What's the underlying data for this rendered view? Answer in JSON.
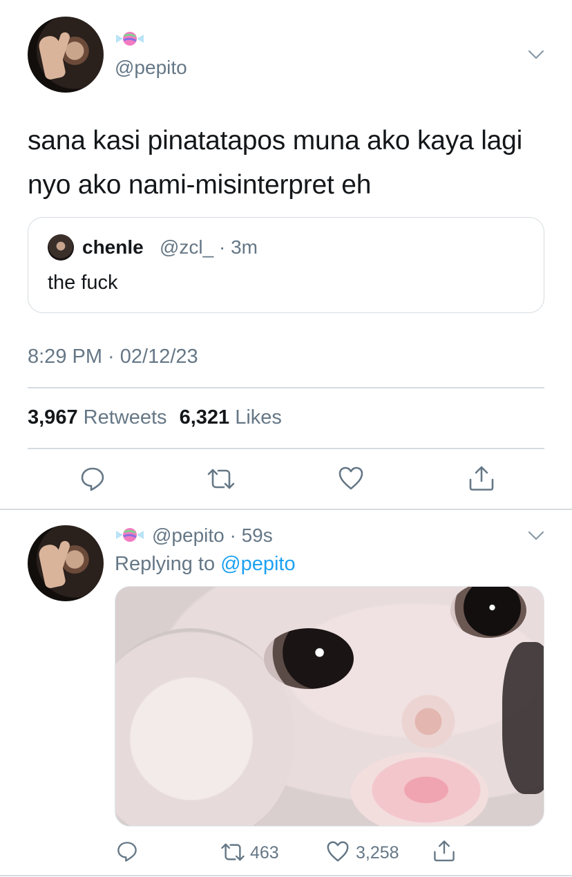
{
  "main_tweet": {
    "handle": "@pepito",
    "text": "sana kasi pinatatapos muna ako kaya lagi nyo ako nami-misinterpret eh",
    "quoted": {
      "name": "chenle",
      "handle_time": "@zcl_ · 3m",
      "text": "the fuck"
    },
    "timestamp": "8:29 PM · 02/12/23",
    "retweets_count": "3,967",
    "retweets_label": "Retweets",
    "likes_count": "6,321",
    "likes_label": "Likes"
  },
  "reply_tweet": {
    "handle_time": "@pepito · 59s",
    "replying_prefix": "Replying to",
    "replying_target": "@pepito",
    "retweet_count": "463",
    "like_count": "3,258"
  },
  "icons": {
    "candy": "candy-icon",
    "menu": "chevron-down-icon",
    "reply": "comment-icon",
    "retweet": "retweet-icon",
    "like": "heart-icon",
    "share": "share-icon"
  },
  "colors": {
    "text": "#14171a",
    "secondary": "#657786",
    "link": "#1da1f2",
    "border": "#d5dbe0"
  }
}
